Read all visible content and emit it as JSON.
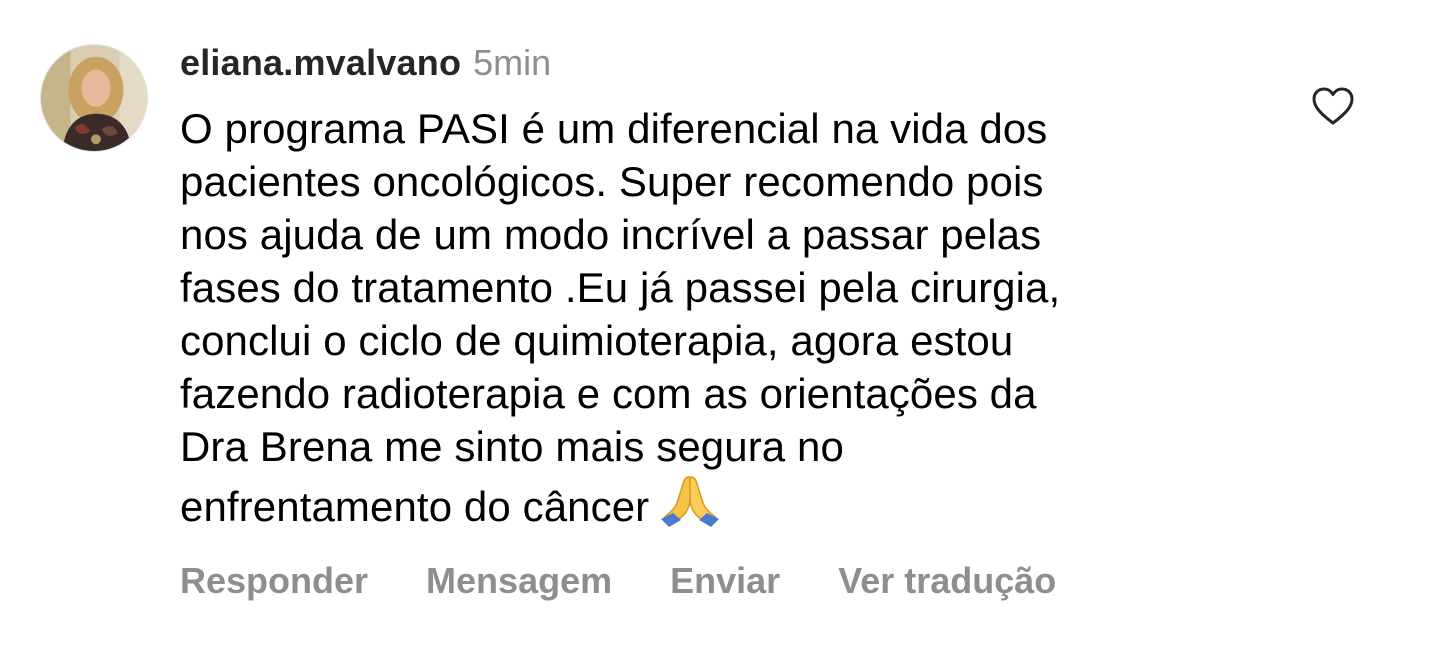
{
  "comment": {
    "username": "eliana.mvalvano",
    "timestamp": "5min",
    "lines": [
      "O programa PASI é um diferencial na vida dos",
      "pacientes oncológicos. Super recomendo pois",
      "nos ajuda de um modo incrível a passar pelas",
      "fases do tratamento .Eu já passei pela cirurgia,",
      "conclui o ciclo de quimioterapia, agora estou",
      "fazendo radioterapia e com as orientações da",
      "Dra Brena me sinto mais segura no",
      "enfrentamento do câncer"
    ],
    "emoji": "folded-hands-emoji",
    "like_icon": "heart-outline-icon"
  },
  "actions": {
    "reply": "Responder",
    "message": "Mensagem",
    "send": "Enviar",
    "translate": "Ver tradução"
  },
  "colors": {
    "text": "#000000",
    "username": "#262626",
    "muted": "#8e8e8e",
    "background": "#ffffff"
  }
}
